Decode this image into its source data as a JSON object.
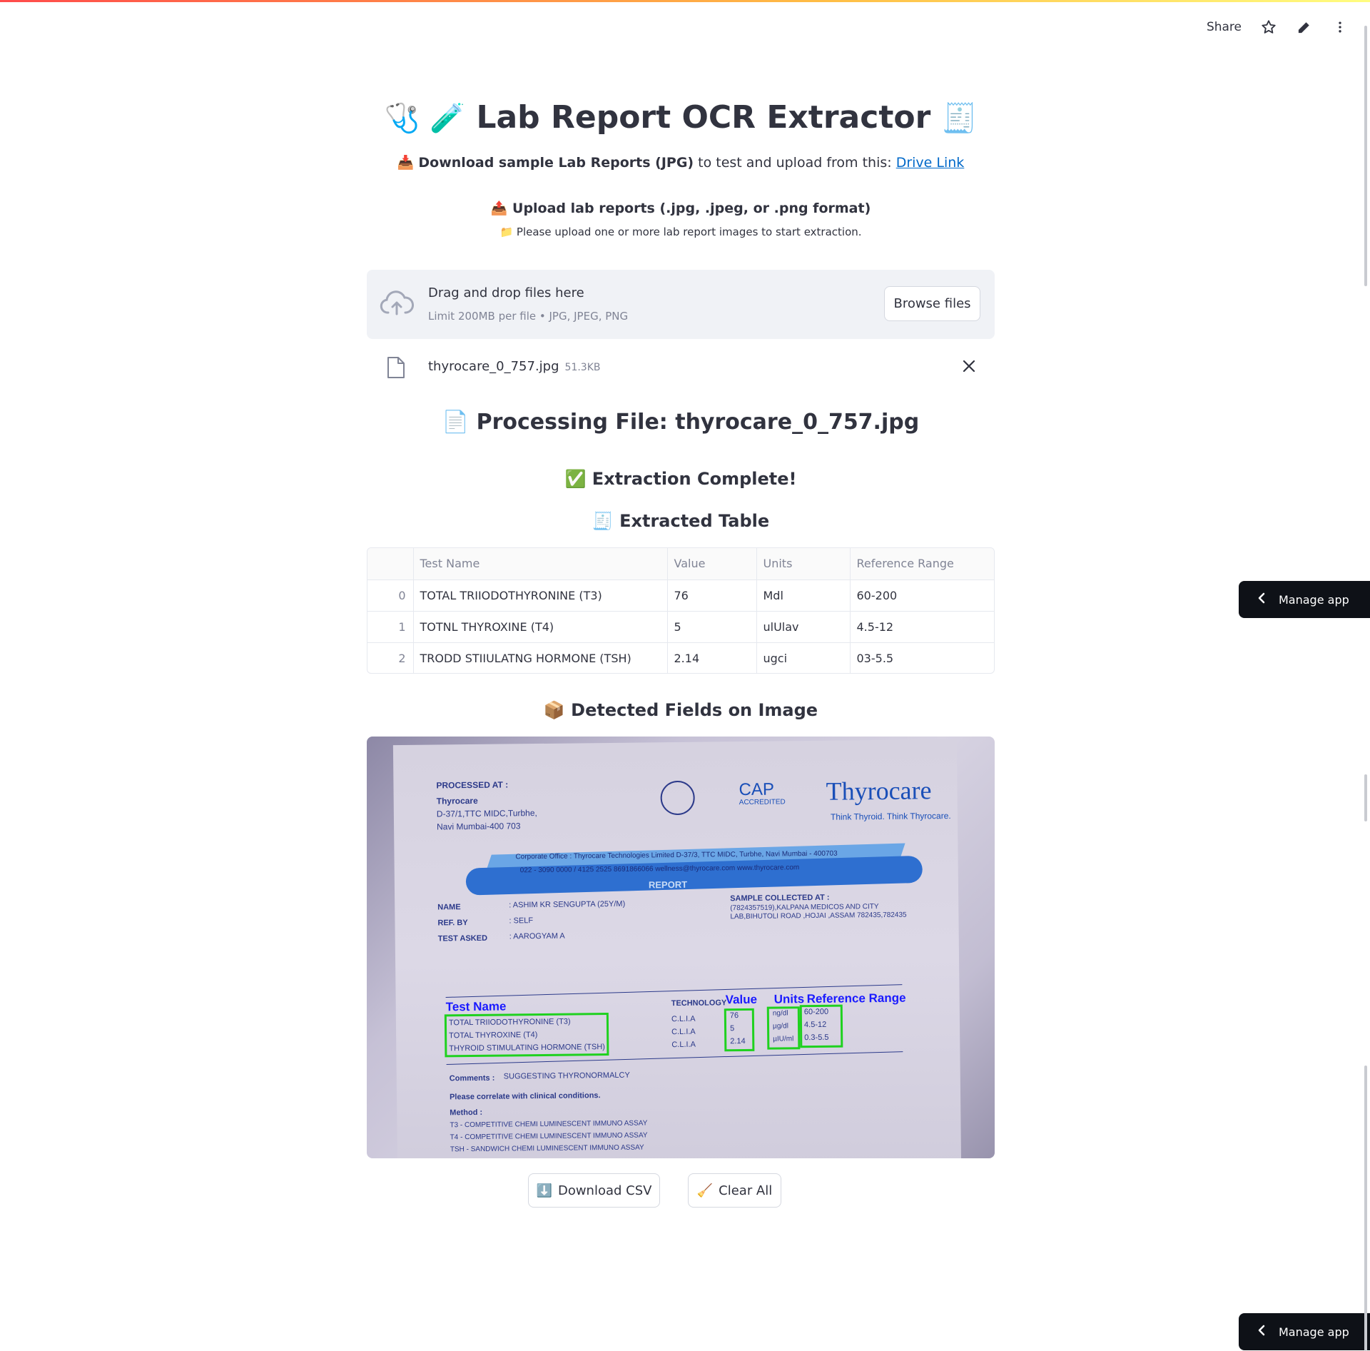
{
  "toolbar": {
    "share_label": "Share",
    "icons": [
      "star-icon",
      "pencil-icon",
      "more-vertical-icon"
    ]
  },
  "header": {
    "emoji_left": "🩺 🧪",
    "title": "Lab Report OCR Extractor",
    "emoji_right": "🧾"
  },
  "download_line": {
    "emoji": "📥",
    "bold_text": "Download sample Lab Reports (JPG)",
    "text": " to test and upload from this: ",
    "link_text": "Drive Link"
  },
  "upload": {
    "emoji": "📤",
    "label": "Upload lab reports (.jpg, .jpeg, or .png format)",
    "hint_emoji": "📁",
    "hint": "Please upload one or more lab report images to start extraction.",
    "dropzone_title": "Drag and drop files here",
    "dropzone_sub": "Limit 200MB per file • JPG, JPEG, PNG",
    "browse_label": "Browse files"
  },
  "file": {
    "name": "thyrocare_0_757.jpg",
    "size": "51.3KB"
  },
  "processing": {
    "emoji": "📄",
    "title": "Processing File: thyrocare_0_757.jpg"
  },
  "status": {
    "emoji": "✅",
    "text": "Extraction Complete!"
  },
  "table_section": {
    "emoji": "🧾",
    "title": "Extracted Table",
    "columns": [
      "",
      "Test Name",
      "Value",
      "Units",
      "Reference Range"
    ],
    "rows": [
      [
        "0",
        "TOTAL TRIIODOTHYRONINE (T3)",
        "76",
        "Mdl",
        "60-200"
      ],
      [
        "1",
        "TOTNL THYROXINE (T4)",
        "5",
        "ulUlav",
        "4.5-12"
      ],
      [
        "2",
        "TRODD STIIULATNG HORMONE (TSH)",
        "2.14",
        "ugci",
        "03-5.5"
      ]
    ]
  },
  "detected": {
    "emoji": "📦",
    "title": "Detected Fields on Image",
    "image": {
      "processed_at": "PROCESSED AT :",
      "lab_name": "Thyrocare",
      "addr1": "D-37/1,TTC MIDC,Turbhe,",
      "addr2": "Navi Mumbai-400 703",
      "cap": "CAP",
      "cap_sub": "ACCREDITED",
      "brand": "Thyrocare",
      "tagline": "Think Thyroid. Think Thyrocare.",
      "corp": "Corporate Office : Thyrocare Technologies Limited  D-37/3, TTC MIDC, Turbhe, Navi Mumbai - 400703",
      "contact": "022 - 3090 0000 / 4125 2525   8691866066   wellness@thyrocare.com   www.thyrocare.com",
      "report": "REPORT",
      "name_label": "NAME",
      "name_val": ": ASHIM KR SENGUPTA (25Y/M)",
      "ref_label": "REF. BY",
      "ref_val": ": SELF",
      "test_label": "TEST ASKED",
      "test_val": ": AAROGYAM A",
      "sample_label": "SAMPLE COLLECTED AT  :",
      "sample_1": "(7824357519),KALPANA MEDICOS AND CITY",
      "sample_2": "LAB,BIHUTOLI ROAD ,HOJAI ,ASSAM 782435,782435",
      "technology": "TECHNOLOGY",
      "ov_test": "Test Name",
      "ov_value": "Value",
      "ov_units": "Units",
      "ov_ref": "Reference Range",
      "tests": [
        "TOTAL TRIIODOTHYRONINE (T3)",
        "TOTAL THYROXINE (T4)",
        "THYROID STIMULATING HORMONE (TSH)"
      ],
      "tech": [
        "C.L.I.A",
        "C.L.I.A",
        "C.L.I.A"
      ],
      "values": [
        "76",
        "5",
        "2.14"
      ],
      "units": [
        "ng/dl",
        "µg/dl",
        "µIU/ml"
      ],
      "ranges": [
        "60-200",
        "4.5-12",
        "0.3-5.5"
      ],
      "comments_label": "Comments :",
      "comments_val": "SUGGESTING THYRONORMALCY",
      "correlate": "Please correlate with clinical conditions.",
      "method_label": "Method :",
      "methods": [
        "T3 - COMPETITIVE  CHEMI LUMINESCENT IMMUNO ASSAY",
        "T4 - COMPETITIVE CHEMI LUMINESCENT IMMUNO ASSAY",
        "TSH - SANDWICH CHEMI LUMINESCENT IMMUNO ASSAY"
      ]
    }
  },
  "actions": {
    "download_emoji": "⬇️",
    "download_label": "Download CSV",
    "clear_emoji": "🧹",
    "clear_label": "Clear All"
  },
  "manage_app": {
    "label": "Manage app"
  }
}
